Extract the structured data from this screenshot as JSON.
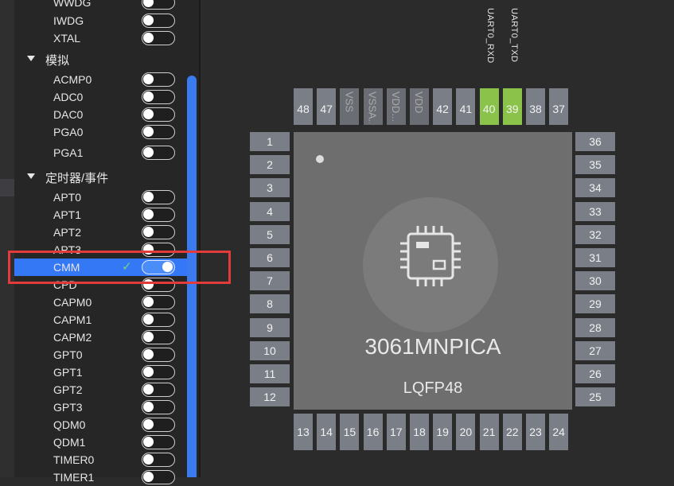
{
  "sidebar": {
    "items_top": [
      {
        "label": "WWDG",
        "on": false
      },
      {
        "label": "IWDG",
        "on": false
      },
      {
        "label": "XTAL",
        "on": false
      }
    ],
    "group_analog": {
      "label": "模拟"
    },
    "items_analog": [
      {
        "label": "ACMP0",
        "on": false
      },
      {
        "label": "ADC0",
        "on": false
      },
      {
        "label": "DAC0",
        "on": false
      },
      {
        "label": "PGA0",
        "on": false
      },
      {
        "label": "PGA1",
        "on": false
      }
    ],
    "group_timer": {
      "label": "定时器/事件"
    },
    "items_timer": [
      {
        "label": "APT0",
        "on": false
      },
      {
        "label": "APT1",
        "on": false
      },
      {
        "label": "APT2",
        "on": false
      },
      {
        "label": "APT3",
        "on": false
      },
      {
        "label": "CMM",
        "on": true,
        "selected": true
      },
      {
        "label": "CPD",
        "on": false
      },
      {
        "label": "CAPM0",
        "on": false
      },
      {
        "label": "CAPM1",
        "on": false
      },
      {
        "label": "CAPM2",
        "on": false
      },
      {
        "label": "GPT0",
        "on": false
      },
      {
        "label": "GPT1",
        "on": false
      },
      {
        "label": "GPT2",
        "on": false
      },
      {
        "label": "GPT3",
        "on": false
      },
      {
        "label": "QDM0",
        "on": false
      },
      {
        "label": "QDM1",
        "on": false
      },
      {
        "label": "TIMER0",
        "on": false
      },
      {
        "label": "TIMER1",
        "on": false
      }
    ]
  },
  "chip": {
    "name": "3061MNPICA",
    "package": "LQFP48",
    "pins_top": [
      {
        "label": "48"
      },
      {
        "label": "47"
      },
      {
        "label": "VSS",
        "power": true
      },
      {
        "label": "VSSA...",
        "power": true
      },
      {
        "label": "VDD...",
        "power": true
      },
      {
        "label": "VDD",
        "power": true
      },
      {
        "label": "42"
      },
      {
        "label": "41"
      },
      {
        "label": "40",
        "active": true
      },
      {
        "label": "39",
        "active": true
      },
      {
        "label": "38"
      },
      {
        "label": "37"
      }
    ],
    "pins_left": [
      "1",
      "2",
      "3",
      "4",
      "5",
      "6",
      "7",
      "8",
      "9",
      "10",
      "11",
      "12"
    ],
    "pins_right": [
      "36",
      "35",
      "34",
      "33",
      "32",
      "31",
      "30",
      "29",
      "28",
      "27",
      "26",
      "25"
    ],
    "pins_bottom": [
      "13",
      "14",
      "15",
      "16",
      "17",
      "18",
      "19",
      "20",
      "21",
      "22",
      "23",
      "24"
    ],
    "signals": [
      {
        "label": "UART0_RXD",
        "pin": "40"
      },
      {
        "label": "UART0_TXD",
        "pin": "39"
      }
    ]
  },
  "colors": {
    "accent": "#3478f6",
    "pin_active": "#8bc34a",
    "highlight_box": "#e23b3b"
  },
  "icons": {
    "chip": "chip-icon",
    "check": "check-icon",
    "caret": "caret-down-icon"
  }
}
